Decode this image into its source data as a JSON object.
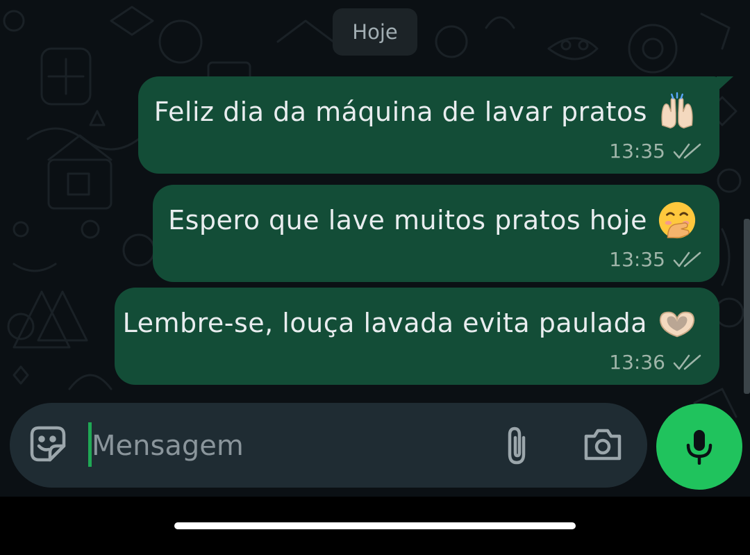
{
  "chat": {
    "date_label": "Hoje",
    "messages": [
      {
        "text": "Feliz dia da máquina de lavar pratos",
        "emoji": "raising-hands",
        "time": "13:35",
        "status": "delivered"
      },
      {
        "text": "Espero que lave muitos pratos hoje",
        "emoji": "face-with-hand-over-mouth",
        "time": "13:35",
        "status": "delivered"
      },
      {
        "text": "Lembre-se, louça lavada evita paulada",
        "emoji": "heart-hands",
        "time": "13:36",
        "status": "delivered"
      }
    ]
  },
  "composer": {
    "placeholder": "Mensagem",
    "icons": {
      "sticker": "sticker-icon",
      "attach": "paperclip-icon",
      "camera": "camera-icon",
      "mic": "mic-icon"
    }
  },
  "colors": {
    "background": "#0b1014",
    "bubble_outgoing": "#134d37",
    "date_chip": "#1f2c33",
    "input_bar": "#1f2c33",
    "accent_green": "#20c35d",
    "meta_text": "#9fb5a9"
  }
}
